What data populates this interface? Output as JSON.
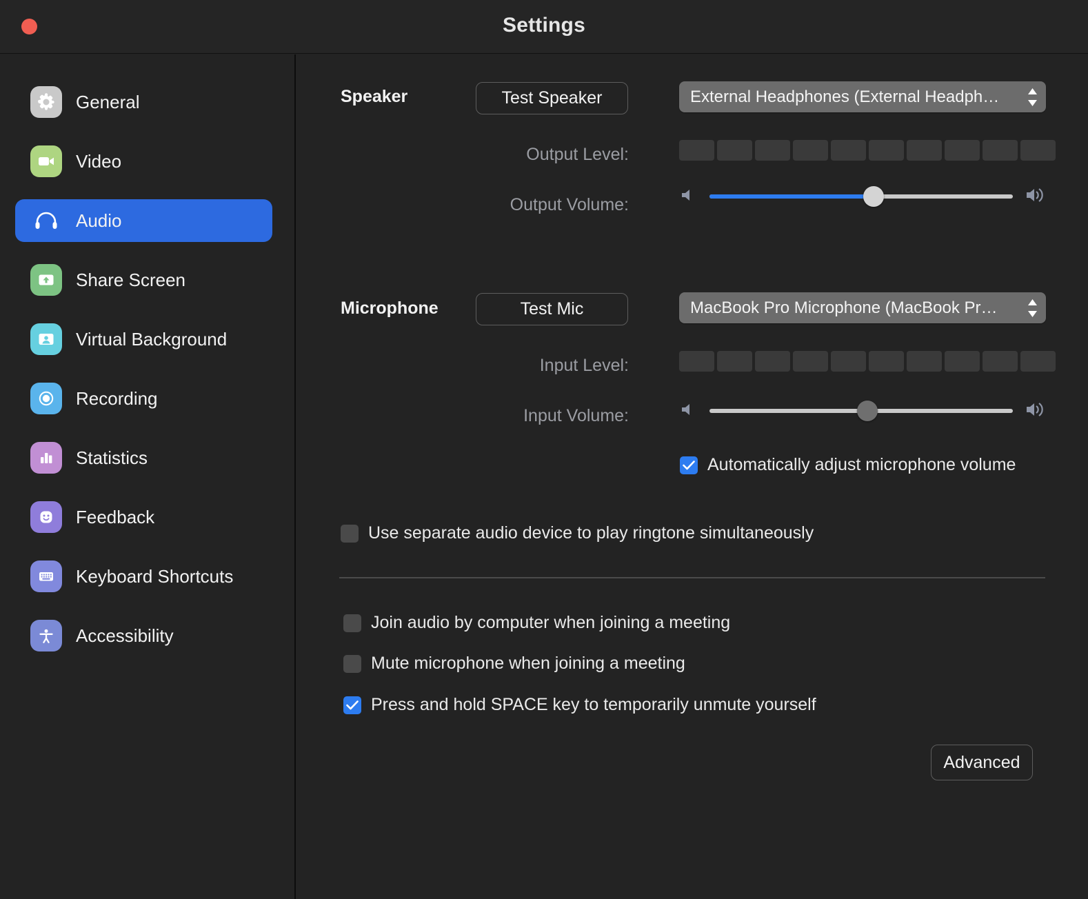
{
  "window": {
    "title": "Settings",
    "close_button": "close-window",
    "accent_color": "#2d6ae0",
    "background_color": "#232323"
  },
  "sidebar": {
    "items": [
      {
        "label": "General",
        "icon": "gear-icon",
        "icon_color": "#c9c9c9",
        "selected": false
      },
      {
        "label": "Video",
        "icon": "video-camera-icon",
        "icon_color": "#aed581",
        "selected": false
      },
      {
        "label": "Audio",
        "icon": "headphones-icon",
        "icon_color": "#2d6ae0",
        "selected": true
      },
      {
        "label": "Share Screen",
        "icon": "share-screen-icon",
        "icon_color": "#7dc383",
        "selected": false
      },
      {
        "label": "Virtual Background",
        "icon": "person-card-icon",
        "icon_color": "#66d0e0",
        "selected": false
      },
      {
        "label": "Recording",
        "icon": "record-circle-icon",
        "icon_color": "#5ab4ec",
        "selected": false
      },
      {
        "label": "Statistics",
        "icon": "bar-chart-icon",
        "icon_color": "#c18fd4",
        "selected": false
      },
      {
        "label": "Feedback",
        "icon": "smiley-face-icon",
        "icon_color": "#8f7ddb",
        "selected": false
      },
      {
        "label": "Keyboard Shortcuts",
        "icon": "keyboard-icon",
        "icon_color": "#8189dd",
        "selected": false
      },
      {
        "label": "Accessibility",
        "icon": "accessibility-icon",
        "icon_color": "#7b8ad6",
        "selected": false
      }
    ]
  },
  "speaker": {
    "section_label": "Speaker",
    "test_button": "Test Speaker",
    "device": "External Headphones (External Headph…",
    "output_level_label": "Output Level:",
    "output_level_segments": 10,
    "output_level_active": 0,
    "output_volume_label": "Output Volume:",
    "output_volume_percent": 54
  },
  "microphone": {
    "section_label": "Microphone",
    "test_button": "Test Mic",
    "device": "MacBook Pro Microphone (MacBook Pr…",
    "input_level_label": "Input Level:",
    "input_level_segments": 10,
    "input_level_active": 0,
    "input_volume_label": "Input Volume:",
    "input_volume_percent": 52,
    "auto_adjust": {
      "label": "Automatically adjust microphone volume",
      "checked": true
    }
  },
  "options": {
    "separate_ringtone": {
      "label": "Use separate audio device to play ringtone simultaneously",
      "checked": false
    },
    "join_audio": {
      "label": "Join audio by computer when joining a meeting",
      "checked": false
    },
    "mute_mic": {
      "label": "Mute microphone when joining a meeting",
      "checked": false
    },
    "press_space": {
      "label": "Press and hold SPACE key to temporarily unmute yourself",
      "checked": true
    }
  },
  "footer": {
    "advanced_button": "Advanced"
  }
}
